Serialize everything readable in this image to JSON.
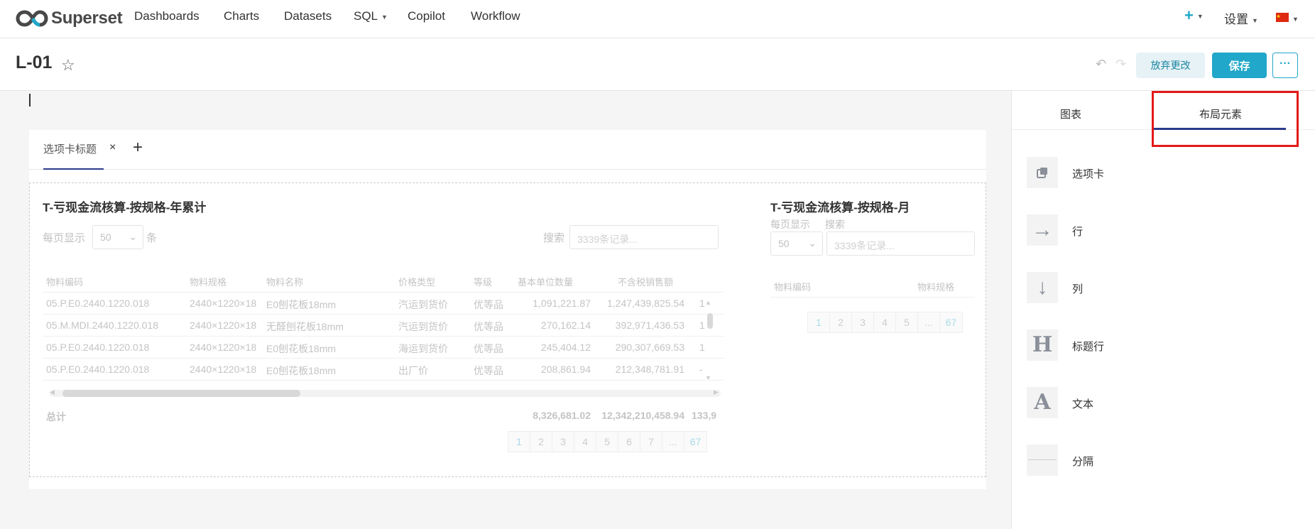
{
  "brand": {
    "name": "Superset"
  },
  "nav": {
    "dashboards": "Dashboards",
    "charts": "Charts",
    "datasets": "Datasets",
    "sql": "SQL",
    "copilot": "Copilot",
    "workflow": "Workflow",
    "plus": "+",
    "settings": "设置"
  },
  "header": {
    "title": "L-01",
    "discard": "放弃更改",
    "save": "保存",
    "more": "···"
  },
  "tabs": {
    "active_label": "选项卡标题",
    "close": "×",
    "add": "+"
  },
  "chart1": {
    "title": "T-亏现金流核算-按规格-年累计",
    "per_page_prefix": "每页显示",
    "per_page_value": "50",
    "per_page_suffix": "条",
    "search_label": "搜索",
    "search_placeholder": "3339条记录...",
    "columns": [
      "物料编码",
      "物料规格",
      "物料名称",
      "价格类型",
      "等级",
      "基本单位数量",
      "不含税销售额"
    ],
    "rows": [
      [
        "05.P.E0.2440.1220.018",
        "2440×1220×18",
        "E0刨花板18mm",
        "汽运到货价",
        "优等品",
        "1,091,221.87",
        "1,247,439,825.54",
        "1"
      ],
      [
        "05.M.MDI.2440.1220.018",
        "2440×1220×18",
        "无醛刨花板18mm",
        "汽运到货价",
        "优等品",
        "270,162.14",
        "392,971,436.53",
        "1"
      ],
      [
        "05.P.E0.2440.1220.018",
        "2440×1220×18",
        "E0刨花板18mm",
        "海运到货价",
        "优等品",
        "245,404.12",
        "290,307,669.53",
        "1"
      ],
      [
        "05.P.E0.2440.1220.018",
        "2440×1220×18",
        "E0刨花板18mm",
        "出厂价",
        "优等品",
        "208,861.94",
        "212,348,781.91",
        "-"
      ]
    ],
    "total_label": "总计",
    "total_qty": "8,326,681.02",
    "total_sales": "12,342,210,458.94",
    "total_extra": "133,9",
    "pages": [
      "1",
      "2",
      "3",
      "4",
      "5",
      "6",
      "7",
      "...",
      "67"
    ]
  },
  "chart2": {
    "title": "T-亏现金流核算-按规格-月",
    "per_page_prefix": "每页显示",
    "search_label": "搜索",
    "per_page_value": "50",
    "search_placeholder": "3339条记录...",
    "columns": [
      "物料编码",
      "物料规格"
    ],
    "pages": [
      "1",
      "2",
      "3",
      "4",
      "5",
      "...",
      "67"
    ]
  },
  "panel": {
    "tab_charts": "图表",
    "tab_layout": "布局元素",
    "items": [
      {
        "label": "选项卡",
        "icon": "tabs-icon"
      },
      {
        "label": "行",
        "icon": "arrow-right-icon"
      },
      {
        "label": "列",
        "icon": "arrow-down-icon"
      },
      {
        "label": "标题行",
        "icon": "header-icon"
      },
      {
        "label": "文本",
        "icon": "text-icon"
      },
      {
        "label": "分隔",
        "icon": "divider-icon"
      }
    ]
  },
  "colors": {
    "primary": "#20a7c9",
    "tab_underline": "#2b3a8c",
    "highlight": "#e41818"
  }
}
